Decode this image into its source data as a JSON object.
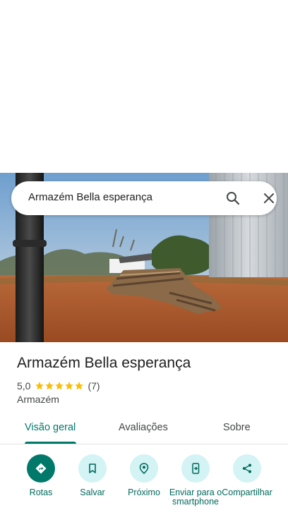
{
  "search": {
    "query": "Armazém Bella esperança"
  },
  "place": {
    "title": "Armazém Bella esperança",
    "rating": "5,0",
    "stars": 5,
    "review_count": "(7)",
    "category": "Armazém"
  },
  "tabs": [
    {
      "label": "Visão geral",
      "active": true
    },
    {
      "label": "Avaliações",
      "active": false
    },
    {
      "label": "Sobre",
      "active": false
    }
  ],
  "actions": [
    {
      "label": "Rotas",
      "icon": "directions-icon"
    },
    {
      "label": "Salvar",
      "icon": "bookmark-icon"
    },
    {
      "label": "Próximo",
      "icon": "nearby-icon"
    },
    {
      "label": "Enviar para o smartphone",
      "icon": "send-to-phone-icon"
    },
    {
      "label": "Compartilhar",
      "icon": "share-icon"
    }
  ],
  "colors": {
    "accent": "#00796b",
    "action_bg": "#d3f3f5",
    "star": "#fbbc04"
  }
}
